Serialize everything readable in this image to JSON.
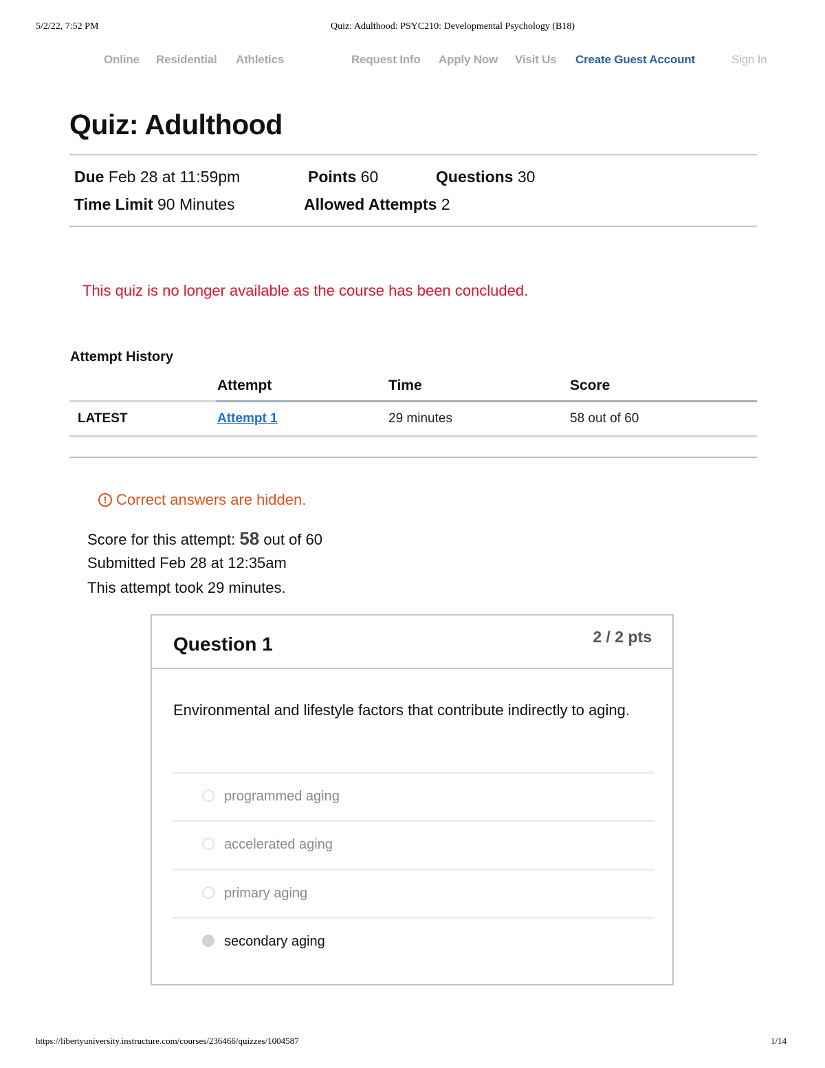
{
  "print_header": {
    "datetime": "5/2/22, 7:52 PM",
    "page_title": "Quiz: Adulthood: PSYC210: Developmental Psychology (B18)"
  },
  "nav": {
    "left": [
      "Online",
      "Residential",
      "Athletics"
    ],
    "right": [
      "Request Info",
      "Apply Now",
      "Visit Us"
    ],
    "create_guest_account": "Create Guest Account",
    "sign_in": "Sign In",
    "accent_color": "#2a5f9e"
  },
  "quiz": {
    "title": "Quiz: Adulthood",
    "due_label": "Due",
    "due_value": "Feb 28 at 11:59pm",
    "points_label": "Points",
    "points_value": "60",
    "questions_label": "Questions",
    "questions_value": "30",
    "time_limit_label": "Time Limit",
    "time_limit_value": "90 Minutes",
    "allowed_attempts_label": "Allowed Attempts",
    "allowed_attempts_value": "2",
    "unavailable_message": "This quiz is no longer available as the course has been concluded."
  },
  "attempt_history": {
    "title": "Attempt History",
    "columns": [
      "",
      "Attempt",
      "Time",
      "Score"
    ],
    "rows": [
      {
        "tag": "LATEST",
        "attempt": "Attempt 1",
        "time": "29 minutes",
        "score": "58 out of 60"
      }
    ]
  },
  "result": {
    "hidden_notice": "Correct answers are hidden.",
    "score_prefix": "Score for this attempt:",
    "score_value": "58",
    "score_suffix": "out of 60",
    "submitted": "Submitted Feb 28 at 12:35am",
    "duration": "This attempt took 29 minutes."
  },
  "question": {
    "title": "Question 1",
    "points": "2 / 2 pts",
    "text": "Environmental and lifestyle factors that contribute indirectly to aging.",
    "answers": [
      {
        "label": "programmed aging",
        "selected": false
      },
      {
        "label": "accelerated aging",
        "selected": false
      },
      {
        "label": "primary aging",
        "selected": false
      },
      {
        "label": "secondary aging",
        "selected": true
      }
    ]
  },
  "print_footer": {
    "url": "https://libertyuniversity.instructure.com/courses/236466/quizzes/1004587",
    "page": "1/14"
  }
}
